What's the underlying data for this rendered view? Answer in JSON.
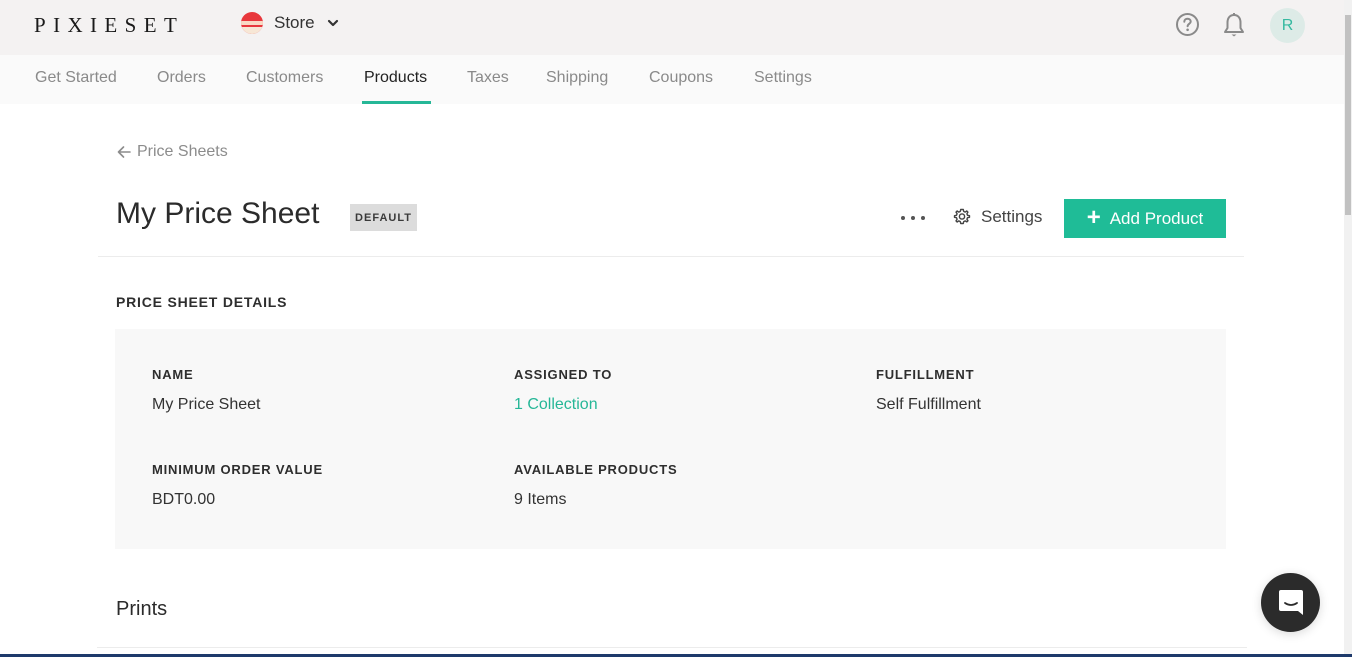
{
  "header": {
    "logo": "PIXIESET",
    "store_label": "Store",
    "avatar_initial": "R",
    "icons": [
      "help-icon",
      "bell-icon"
    ]
  },
  "nav": {
    "items": [
      {
        "label": "Get Started",
        "active": false
      },
      {
        "label": "Orders",
        "active": false
      },
      {
        "label": "Customers",
        "active": false
      },
      {
        "label": "Products",
        "active": true
      },
      {
        "label": "Taxes",
        "active": false
      },
      {
        "label": "Shipping",
        "active": false
      },
      {
        "label": "Coupons",
        "active": false
      },
      {
        "label": "Settings",
        "active": false
      }
    ]
  },
  "breadcrumb": {
    "back_label": "Price Sheets"
  },
  "page": {
    "title": "My Price Sheet",
    "badge": "DEFAULT",
    "settings_label": "Settings",
    "add_product_label": "Add Product"
  },
  "details": {
    "section_title": "PRICE SHEET DETAILS",
    "name_label": "NAME",
    "name_value": "My Price Sheet",
    "assigned_label": "ASSIGNED TO",
    "assigned_value": "1 Collection",
    "fulfillment_label": "FULFILLMENT",
    "fulfillment_value": "Self Fulfillment",
    "min_order_label": "MINIMUM ORDER VALUE",
    "min_order_value": "BDT0.00",
    "available_label": "AVAILABLE PRODUCTS",
    "available_value": "9 Items"
  },
  "prints": {
    "title": "Prints"
  },
  "colors": {
    "accent": "#1fbc97",
    "link": "#26b797",
    "topbar_bg": "#f4f2f2",
    "details_bg": "#f8f8f8"
  }
}
